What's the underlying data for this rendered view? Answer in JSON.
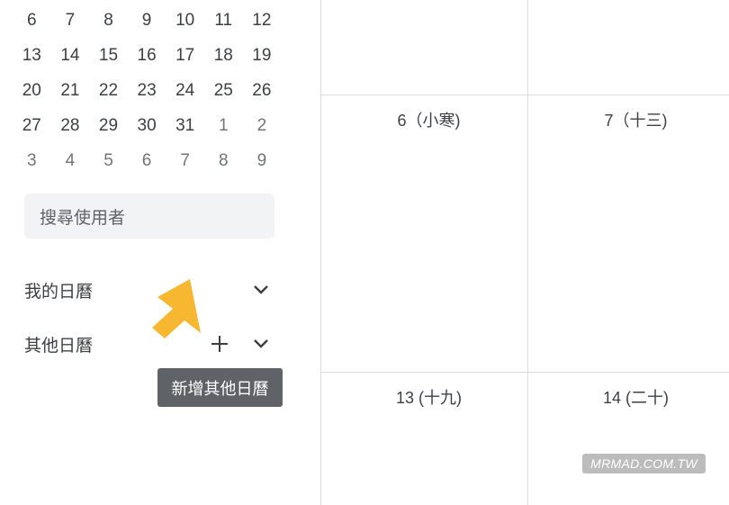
{
  "mini_calendar": {
    "weeks": [
      [
        {
          "d": "6",
          "o": false
        },
        {
          "d": "7",
          "o": false
        },
        {
          "d": "8",
          "o": false
        },
        {
          "d": "9",
          "o": false
        },
        {
          "d": "10",
          "o": false
        },
        {
          "d": "11",
          "o": false
        },
        {
          "d": "12",
          "o": false
        }
      ],
      [
        {
          "d": "13",
          "o": false
        },
        {
          "d": "14",
          "o": false
        },
        {
          "d": "15",
          "o": false
        },
        {
          "d": "16",
          "o": false
        },
        {
          "d": "17",
          "o": false
        },
        {
          "d": "18",
          "o": false
        },
        {
          "d": "19",
          "o": false
        }
      ],
      [
        {
          "d": "20",
          "o": false
        },
        {
          "d": "21",
          "o": false
        },
        {
          "d": "22",
          "o": false
        },
        {
          "d": "23",
          "o": false
        },
        {
          "d": "24",
          "o": false
        },
        {
          "d": "25",
          "o": false
        },
        {
          "d": "26",
          "o": false
        }
      ],
      [
        {
          "d": "27",
          "o": false
        },
        {
          "d": "28",
          "o": false
        },
        {
          "d": "29",
          "o": false
        },
        {
          "d": "30",
          "o": false
        },
        {
          "d": "31",
          "o": false
        },
        {
          "d": "1",
          "o": true
        },
        {
          "d": "2",
          "o": true
        }
      ],
      [
        {
          "d": "3",
          "o": true
        },
        {
          "d": "4",
          "o": true
        },
        {
          "d": "5",
          "o": true
        },
        {
          "d": "6",
          "o": true
        },
        {
          "d": "7",
          "o": true
        },
        {
          "d": "8",
          "o": true
        },
        {
          "d": "9",
          "o": true
        }
      ]
    ]
  },
  "search": {
    "placeholder": "搜尋使用者"
  },
  "my_calendars": {
    "label": "我的日曆"
  },
  "other_calendars": {
    "label": "其他日曆"
  },
  "tooltip": {
    "text": "新增其他日曆"
  },
  "month_cells": [
    {
      "label": "6（小寒)"
    },
    {
      "label": "7（十三)"
    },
    {
      "label": "13 (十九)"
    },
    {
      "label": "14 (二十)"
    }
  ],
  "watermark": {
    "text": "MRMAD.COM.TW"
  },
  "colors": {
    "pointer_arrow": "#f7b731",
    "tooltip_bg": "#5f6368",
    "search_bg": "#f1f3f4",
    "grid_line": "#dadce0"
  },
  "icons": {
    "my_calendars_toggle": "chevron-down-icon",
    "other_calendars_toggle": "chevron-down-icon",
    "add_other_calendar": "plus-icon",
    "annotation": "arrow-pointer-icon"
  }
}
